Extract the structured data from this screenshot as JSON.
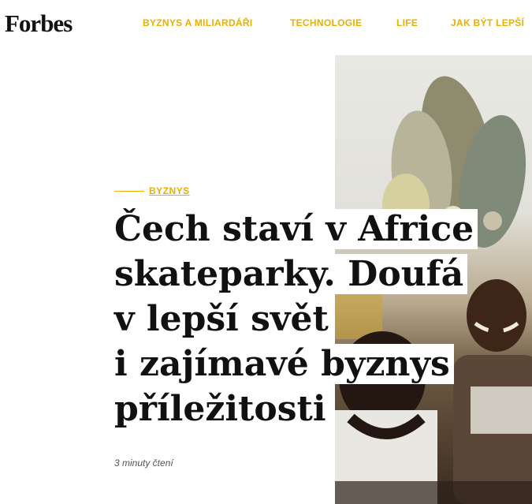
{
  "header": {
    "logo": "Forbes",
    "nav": [
      "BYZNYS A MILIARDÁŘI",
      "TECHNOLOGIE",
      "LIFE",
      "JAK BÝT LEPŠÍ"
    ]
  },
  "article": {
    "category": "BYZNYS",
    "headline_lines": [
      "Čech staví v Africe",
      "skateparky. Doufá",
      "v lepší svět",
      "i zajímavé byznys",
      "příležitosti"
    ],
    "read_time": "3 minuty čtení"
  },
  "colors": {
    "accent": "#e8b000",
    "text": "#111111"
  }
}
